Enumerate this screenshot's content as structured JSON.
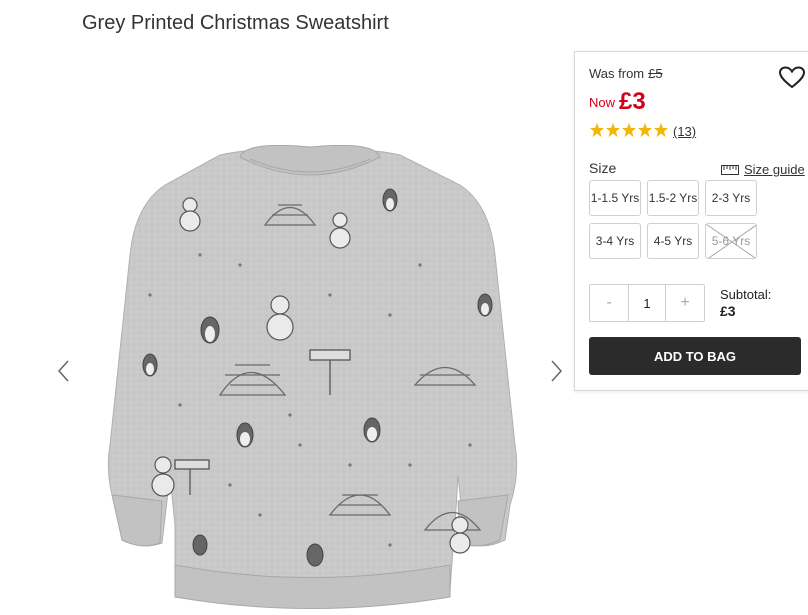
{
  "product": {
    "title": "Grey Printed Christmas Sweatshirt",
    "image_icon": "sweatshirt-product-image"
  },
  "price": {
    "was_label": "Was from",
    "was_value": "£5",
    "now_label": "Now",
    "now_value": "£3",
    "now_color": "#d0021b"
  },
  "rating": {
    "stars": 5,
    "reviews": "(13)",
    "star_color": "#f2b705"
  },
  "size": {
    "label": "Size",
    "guide_label": "Size guide",
    "options": [
      {
        "label": "1-1.5 Yrs",
        "available": true
      },
      {
        "label": "1.5-2 Yrs",
        "available": true
      },
      {
        "label": "2-3 Yrs",
        "available": true
      },
      {
        "label": "3-4 Yrs",
        "available": true
      },
      {
        "label": "4-5 Yrs",
        "available": true
      },
      {
        "label": "5-6 Yrs",
        "available": false
      }
    ]
  },
  "quantity": {
    "minus": "-",
    "value": "1",
    "plus": "+"
  },
  "subtotal": {
    "label": "Subtotal:",
    "value": "£3"
  },
  "add_to_bag": "ADD TO BAG",
  "colors": {
    "button_bg": "#2b2b2b"
  }
}
